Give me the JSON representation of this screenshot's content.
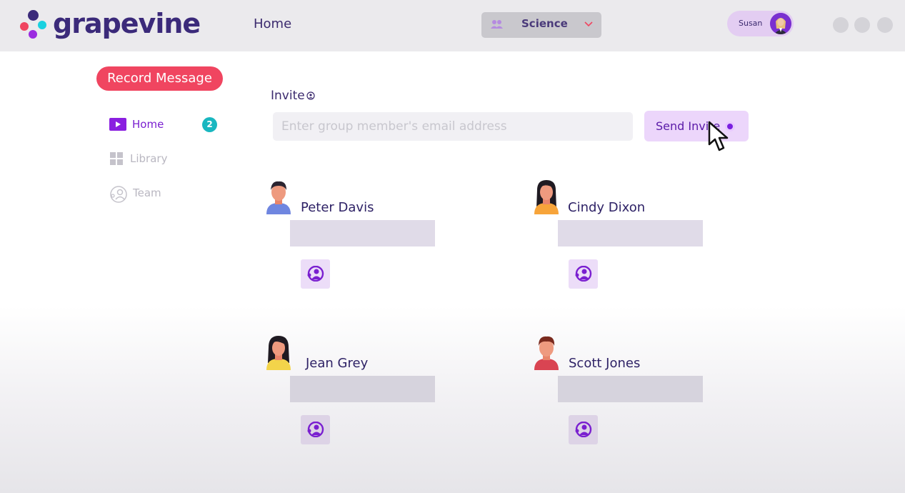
{
  "app": {
    "name": "grapevine",
    "colors": {
      "brand_purple": "#3b2a7a",
      "accent_red": "#f04560",
      "badge_teal": "#19b7c0",
      "accent_violet": "#7a1fe0"
    }
  },
  "header": {
    "nav_home": "Home",
    "group_select": {
      "value": "Science",
      "icon": "group-icon"
    },
    "user": {
      "name": "Susan",
      "icon": "user-avatar"
    }
  },
  "sidebar": {
    "record_button": "Record Message",
    "items": [
      {
        "label": "Home",
        "icon": "play-icon",
        "badge": "2",
        "active": true
      },
      {
        "label": "Library",
        "icon": "grid-icon",
        "active": false
      },
      {
        "label": "Team",
        "icon": "team-icon",
        "active": false
      }
    ]
  },
  "invite": {
    "label": "Invite",
    "email_placeholder": "Enter group member's email address",
    "email_value": "",
    "send_button": "Send Invite"
  },
  "members": [
    {
      "name": "Peter Davis"
    },
    {
      "name": "Cindy Dixon"
    },
    {
      "name": "Jean Grey"
    },
    {
      "name": "Scott Jones"
    }
  ]
}
